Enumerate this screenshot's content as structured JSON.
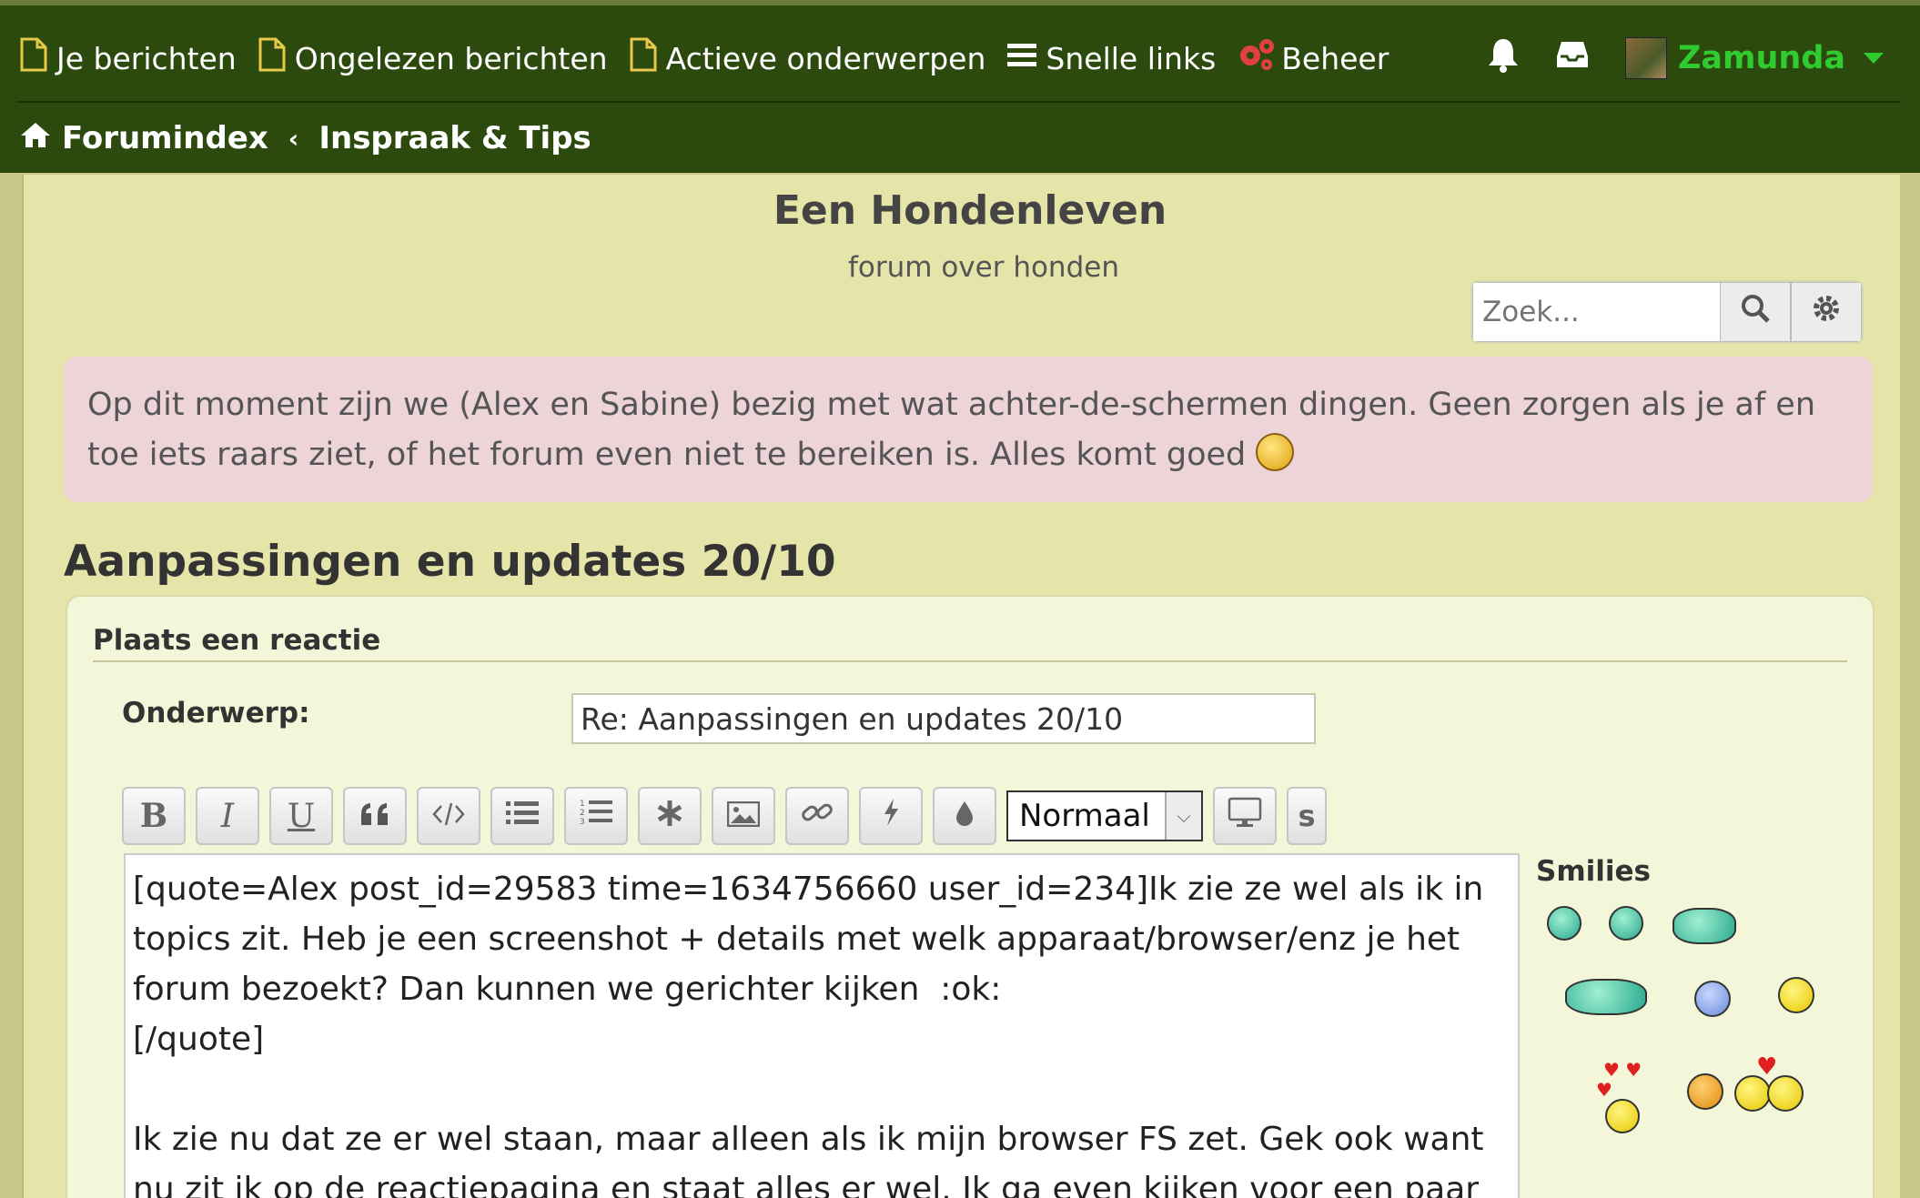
{
  "nav": {
    "items": [
      {
        "label": "Je berichten",
        "icon": "file-icon"
      },
      {
        "label": "Ongelezen berichten",
        "icon": "file-icon"
      },
      {
        "label": "Actieve onderwerpen",
        "icon": "file-icon"
      },
      {
        "label": "Snelle links",
        "icon": "menu-icon"
      },
      {
        "label": "Beheer",
        "icon": "cogs-icon"
      }
    ],
    "username": "Zamunda",
    "username_color": "#2fcc2f"
  },
  "breadcrumb": {
    "home": "Forumindex",
    "current": "Inspraak & Tips"
  },
  "site": {
    "title": "Een Hondenleven",
    "description": "forum over honden"
  },
  "search": {
    "placeholder": "Zoek..."
  },
  "notice": {
    "text": "Op dit moment zijn we (Alex en Sabine) bezig met wat achter-de-schermen dingen. Geen zorgen als je af en toe iets raars ziet, of het forum even niet te bereiken is. Alles komt goed"
  },
  "topic": {
    "title": "Aanpassingen en updates 20/10"
  },
  "reply": {
    "heading": "Plaats een reactie",
    "subject_label": "Onderwerp:",
    "subject_value": "Re: Aanpassingen en updates 20/10",
    "font_size_option": "Normaal",
    "size_button_label": "s",
    "body": "[quote=Alex post_id=29583 time=1634756660 user_id=234]Ik zie ze wel als ik in topics zit. Heb je een screenshot + details met welk apparaat/browser/enz je het forum bezoekt? Dan kunnen we gerichter kijken  :ok:\n[/quote]\n\nIk zie nu dat ze er wel staan, maar alleen als ik mijn browser FS zet. Gek ook want nu zit ik op de reactiepagina en staat alles er wel. Ik ga even kijken voor een paar",
    "smilies_title": "Smilies"
  },
  "colors": {
    "topbar": "#2d4a0e",
    "page_bg": "#e5e5aa",
    "notice_bg": "#ecd4d8",
    "panel_bg": "#f3f6d8"
  }
}
